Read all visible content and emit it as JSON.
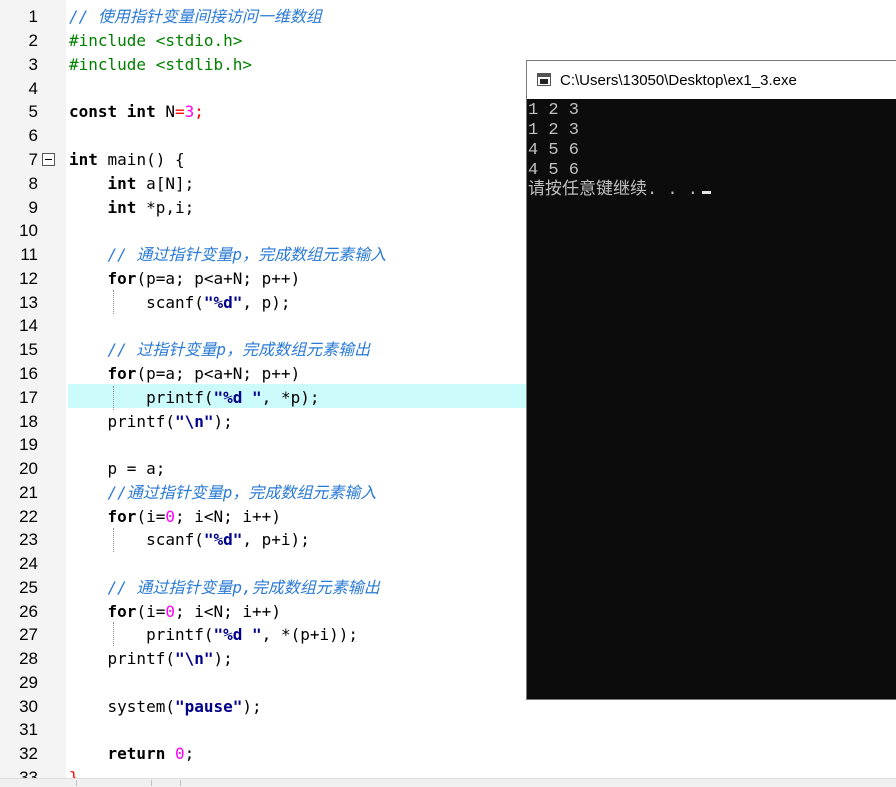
{
  "editor": {
    "lines": [
      {
        "n": "1"
      },
      {
        "n": "2"
      },
      {
        "n": "3"
      },
      {
        "n": "4"
      },
      {
        "n": "5"
      },
      {
        "n": "6"
      },
      {
        "n": "7"
      },
      {
        "n": "8"
      },
      {
        "n": "9"
      },
      {
        "n": "10"
      },
      {
        "n": "11"
      },
      {
        "n": "12"
      },
      {
        "n": "13"
      },
      {
        "n": "14"
      },
      {
        "n": "15"
      },
      {
        "n": "16"
      },
      {
        "n": "17"
      },
      {
        "n": "18"
      },
      {
        "n": "19"
      },
      {
        "n": "20"
      },
      {
        "n": "21"
      },
      {
        "n": "22"
      },
      {
        "n": "23"
      },
      {
        "n": "24"
      },
      {
        "n": "25"
      },
      {
        "n": "26"
      },
      {
        "n": "27"
      },
      {
        "n": "28"
      },
      {
        "n": "29"
      },
      {
        "n": "30"
      },
      {
        "n": "31"
      },
      {
        "n": "32"
      },
      {
        "n": "33"
      }
    ],
    "code": {
      "l1": "// 使用指针变量间接访问一维数组",
      "l2": "#include <stdio.h>",
      "l3": "#include <stdlib.h>",
      "l5_kw": "const int",
      "l5_a": " N",
      "l5_op": "=",
      "l5_num": "3",
      "l5_end": ";",
      "l7_kw": "int",
      "l7_a": " main() {",
      "l8_kw": "int",
      "l8_a": " a[N];",
      "l9_kw": "int",
      "l9_a": " *p,i;",
      "l11": "// 通过指针变量p，完成数组元素输入",
      "l12_kw": "for",
      "l12_a": "(p=a; p<a+N; p++)",
      "l13_a": "scanf(",
      "l13_s": "\"%d\"",
      "l13_b": ", p);",
      "l15": "// 过指针变量p，完成数组元素输出",
      "l16_kw": "for",
      "l16_a": "(p=a; p<a+N; p++)",
      "l17_a": "printf(",
      "l17_s": "\"%d \"",
      "l17_b": ", *p);",
      "l18_a": "printf(",
      "l18_s": "\"\\n\"",
      "l18_b": ");",
      "l20": "p = a;",
      "l21": "//通过指针变量p，完成数组元素输入",
      "l22_kw": "for",
      "l22_a": "(i=",
      "l22_num": "0",
      "l22_b": "; i<N; i++)",
      "l23_a": "scanf(",
      "l23_s": "\"%d\"",
      "l23_b": ", p+i);",
      "l25": "// 通过指针变量p,完成数组元素输出",
      "l26_kw": "for",
      "l26_a": "(i=",
      "l26_num": "0",
      "l26_b": "; i<N; i++)",
      "l27_a": "printf(",
      "l27_s": "\"%d \"",
      "l27_b": ", *(p+i));",
      "l28_a": "printf(",
      "l28_s": "\"\\n\"",
      "l28_b": ");",
      "l30_a": "system(",
      "l30_s": "\"pause\"",
      "l30_b": ");",
      "l32_kw": "return",
      "l32_num": " 0",
      "l32_b": ";",
      "l33": "}"
    },
    "highlighted_line": "17"
  },
  "console": {
    "title": "C:\\Users\\13050\\Desktop\\ex1_3.exe",
    "output": [
      "1 2 3",
      "1 2 3",
      "4 5 6",
      "4 5 6"
    ],
    "prompt": "请按任意键继续. . ."
  },
  "colors": {
    "keyword": "#000000",
    "preprocessor": "#008000",
    "comment": "#2a7ad5",
    "number": "#ff00ff",
    "operator": "#ff0000",
    "highlight": "#ccfbfb",
    "console_bg": "#0c0c0c",
    "console_fg": "#c0c0c0"
  },
  "icons": {
    "fold": "fold-minus-icon",
    "console": "console-window-icon"
  }
}
